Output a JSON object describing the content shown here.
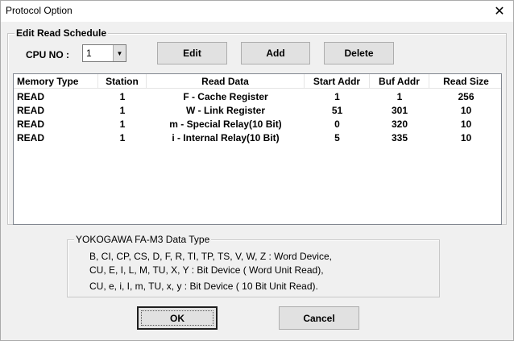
{
  "window": {
    "title": "Protocol Option",
    "close_glyph": "✕"
  },
  "schedule": {
    "legend": "Edit Read Schedule",
    "cpu_label": "CPU NO :",
    "cpu_value": "1",
    "edit_label": "Edit",
    "add_label": "Add",
    "delete_label": "Delete"
  },
  "table": {
    "columns": [
      "Memory Type",
      "Station",
      "Read Data",
      "Start Addr",
      "Buf Addr",
      "Read Size"
    ],
    "rows": [
      [
        "READ",
        "1",
        "F - Cache Register",
        "1",
        "1",
        "256"
      ],
      [
        "READ",
        "1",
        "W - Link Register",
        "51",
        "301",
        "10"
      ],
      [
        "READ",
        "1",
        "m - Special Relay(10 Bit)",
        "0",
        "320",
        "10"
      ],
      [
        "READ",
        "1",
        "i - Internal Relay(10 Bit)",
        "5",
        "335",
        "10"
      ]
    ]
  },
  "info": {
    "legend": "YOKOGAWA FA-M3 Data Type",
    "lines": [
      "B,  CI,  CP,  CS,  D,  F,  R,  TI,  TP,  TS, V,  W,  Z  :  Word Device,",
      "CU, E,  I,  L,  M,  TU,  X,  Y  :  Bit Device ( Word Unit Read),",
      "CU,  e,  i,  I,  m,  TU,  x,  y  :  Bit Device ( 10 Bit Unit Read)."
    ]
  },
  "footer": {
    "ok_label": "OK",
    "cancel_label": "Cancel"
  }
}
